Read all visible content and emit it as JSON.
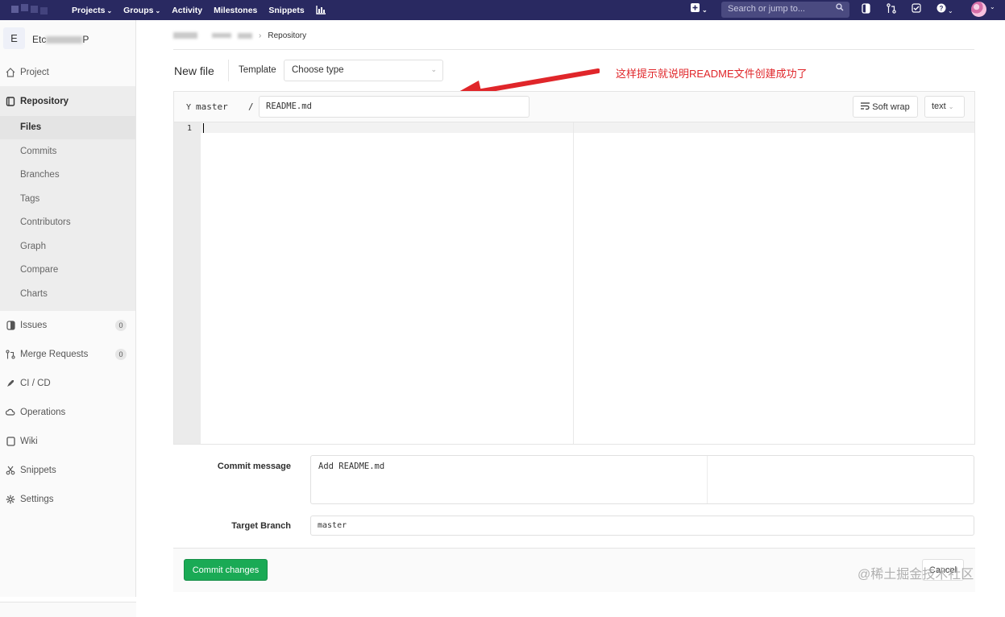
{
  "topbar": {
    "nav": [
      "Projects",
      "Groups",
      "Activity",
      "Milestones",
      "Snippets"
    ],
    "search_placeholder": "Search or jump to..."
  },
  "sidebar": {
    "project_initial": "E",
    "project_name_start": "Etc",
    "project_name_end": "P",
    "items": {
      "project": "Project",
      "repository": "Repository",
      "issues": "Issues",
      "merge_requests": "Merge Requests",
      "cicd": "CI / CD",
      "operations": "Operations",
      "wiki": "Wiki",
      "snippets": "Snippets",
      "settings": "Settings"
    },
    "repo_sub": [
      "Files",
      "Commits",
      "Branches",
      "Tags",
      "Contributors",
      "Graph",
      "Compare",
      "Charts"
    ],
    "issues_count": "0",
    "merge_requests_count": "0"
  },
  "breadcrumb": {
    "last": "Repository"
  },
  "page": {
    "title": "New file",
    "template_label": "Template",
    "template_value": "Choose type",
    "annotation": "这样提示就说明README文件创建成功了"
  },
  "editor": {
    "branch": "master",
    "slash": "/",
    "file_name": "README.md",
    "soft_wrap": "Soft wrap",
    "language": "text",
    "line_number": "1"
  },
  "form": {
    "commit_message_label": "Commit message",
    "commit_message_value": "Add README.md",
    "target_branch_label": "Target Branch",
    "target_branch_value": "master",
    "commit_button": "Commit changes",
    "cancel_button": "Cancel"
  },
  "watermark": "@稀土掘金技术社区",
  "colors": {
    "navbar": "#292961",
    "commit_button": "#1aaa55",
    "annotation": "#e0262a"
  }
}
